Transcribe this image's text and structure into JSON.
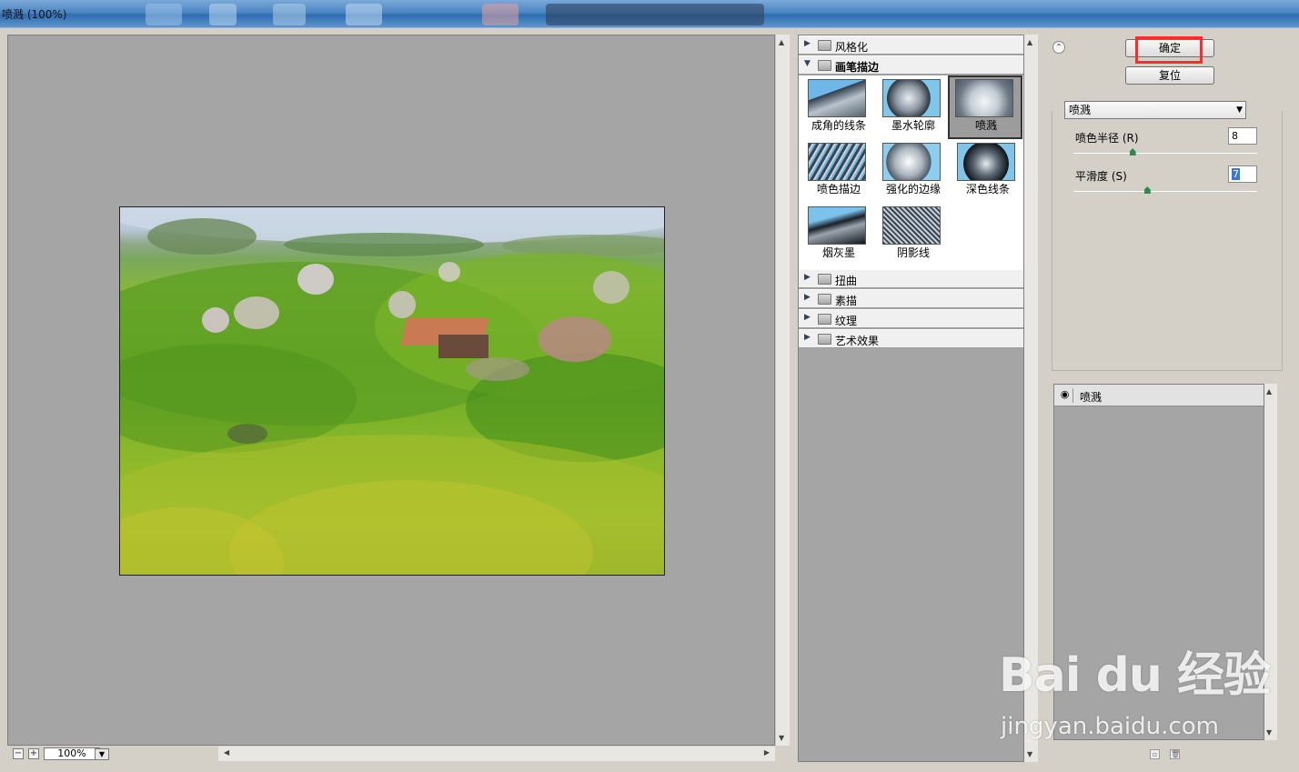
{
  "window": {
    "title": "喷溅 (100%)"
  },
  "preview": {
    "zoom": "100%"
  },
  "gallery": {
    "categories": [
      {
        "label": "风格化",
        "open": false
      },
      {
        "label": "画笔描边",
        "open": true
      },
      {
        "label": "扭曲",
        "open": false
      },
      {
        "label": "素描",
        "open": false
      },
      {
        "label": "纹理",
        "open": false
      },
      {
        "label": "艺术效果",
        "open": false
      }
    ],
    "thumbnails": [
      {
        "label": "成角的线条",
        "selected": false
      },
      {
        "label": "墨水轮廓",
        "selected": false
      },
      {
        "label": "喷溅",
        "selected": true
      },
      {
        "label": "喷色描边",
        "selected": false
      },
      {
        "label": "强化的边缘",
        "selected": false
      },
      {
        "label": "深色线条",
        "selected": false
      },
      {
        "label": "烟灰墨",
        "selected": false
      },
      {
        "label": "阴影线",
        "selected": false
      }
    ]
  },
  "buttons": {
    "ok": "确定",
    "reset": "复位"
  },
  "filter_select": {
    "value": "喷溅"
  },
  "params": {
    "spray_radius": {
      "label": "喷色半径 (R)",
      "value": "8",
      "fraction": 0.32
    },
    "smoothness": {
      "label": "平滑度 (S)",
      "value": "7",
      "fraction": 0.4
    }
  },
  "layers": {
    "name": "喷溅"
  },
  "watermark": {
    "brand": "Bai du 经验",
    "url": "jingyan.baidu.com"
  },
  "colors": {
    "highlight": "#ff2a2a",
    "slider_knob": "#2d8a4d",
    "panel_bg": "#a5a5a5"
  }
}
